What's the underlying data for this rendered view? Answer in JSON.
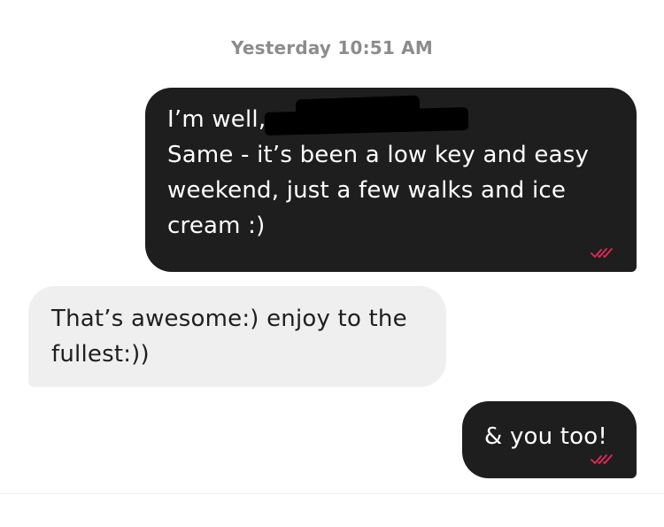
{
  "conversation": {
    "timestamp": "Yesterday 10:51 AM",
    "messages": [
      {
        "direction": "outgoing",
        "lines": [
          "I’m well,",
          "Same - it’s been a low key and easy",
          "weekend, just a few walks and ice",
          "cream :)"
        ],
        "status_icon": "read-receipt-icon"
      },
      {
        "direction": "incoming",
        "lines": [
          "That’s awesome:) enjoy to the",
          "fullest:))"
        ]
      },
      {
        "direction": "outgoing",
        "lines": [
          "& you too!"
        ],
        "status_icon": "read-receipt-icon"
      }
    ]
  },
  "colors": {
    "outgoing_bubble": "#1f1e1f",
    "incoming_bubble": "#efefef",
    "read_receipt": "#e6275a",
    "timestamp_text": "#8c8c8c"
  }
}
